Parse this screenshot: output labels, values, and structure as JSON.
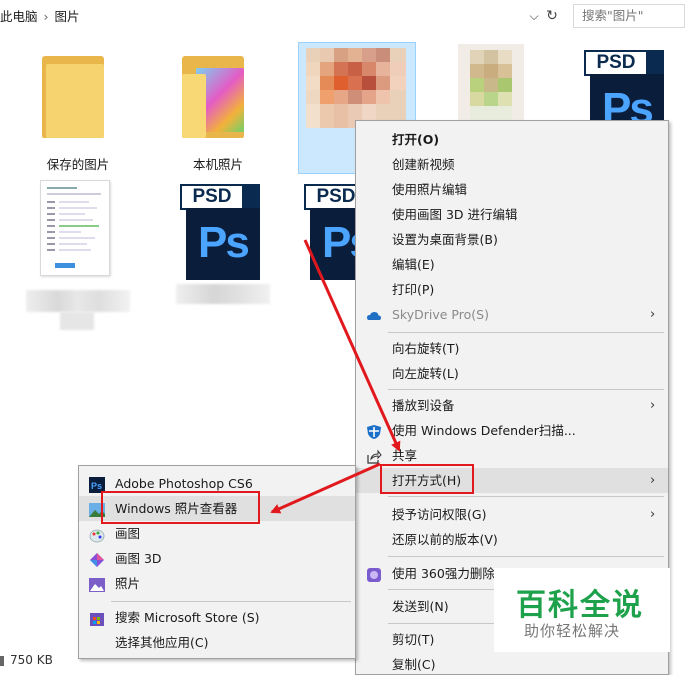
{
  "address_bar": {
    "path": [
      "此电脑",
      "图片"
    ],
    "separator": "›",
    "search_placeholder": "搜索\"图片\""
  },
  "items": [
    {
      "label": "保存的图片",
      "type": "folder"
    },
    {
      "label": "本机照片",
      "type": "folder"
    },
    {
      "label": "",
      "type": "image"
    },
    {
      "label": "",
      "type": "image"
    },
    {
      "label": "",
      "type": "psd"
    },
    {
      "label": "",
      "type": "document"
    },
    {
      "label": "",
      "type": "psd"
    },
    {
      "label": "",
      "type": "psd"
    }
  ],
  "psd_badge": {
    "top": "PSD",
    "body": "Ps"
  },
  "context_menu": {
    "items": [
      {
        "label": "打开(O)",
        "bold": true
      },
      {
        "label": "创建新视频"
      },
      {
        "label": "使用照片编辑"
      },
      {
        "label": "使用画图 3D 进行编辑"
      },
      {
        "label": "设置为桌面背景(B)"
      },
      {
        "label": "编辑(E)"
      },
      {
        "label": "打印(P)"
      },
      {
        "label": "SkyDrive Pro(S)",
        "disabled": true,
        "submenu": true,
        "icon": "cloud-icon"
      },
      {
        "label": "向右旋转(T)"
      },
      {
        "label": "向左旋转(L)"
      },
      {
        "label": "播放到设备",
        "submenu": true
      },
      {
        "label": "使用 Windows Defender扫描...",
        "icon": "defender-shield-icon"
      },
      {
        "label": "共享",
        "icon": "share-icon"
      },
      {
        "label": "打开方式(H)",
        "submenu": true,
        "highlighted": true
      },
      {
        "label": "授予访问权限(G)",
        "submenu": true
      },
      {
        "label": "还原以前的版本(V)"
      },
      {
        "label": "使用 360强力删除",
        "icon": "360-icon"
      },
      {
        "label": "发送到(N)"
      },
      {
        "label": "剪切(T)"
      },
      {
        "label": "复制(C)"
      }
    ]
  },
  "open_with_menu": {
    "items": [
      {
        "label": "Adobe Photoshop CS6",
        "icon": "photoshop-icon"
      },
      {
        "label": "Windows 照片查看器",
        "icon": "photo-viewer-icon",
        "highlighted": true
      },
      {
        "label": "画图",
        "icon": "paint-icon"
      },
      {
        "label": "画图 3D",
        "icon": "paint-3d-icon"
      },
      {
        "label": "照片",
        "icon": "photos-icon"
      },
      {
        "label": "搜索 Microsoft Store (S)",
        "icon": "store-icon"
      },
      {
        "label": "选择其他应用(C)"
      }
    ]
  },
  "status_bar": {
    "size": "750 KB"
  },
  "watermark": {
    "title": "百科全说",
    "subtitle": "助你轻松解决"
  },
  "colors": {
    "annotation_red": "#e1191e",
    "selection": "#cce8ff",
    "menu_bg": "#f2f2f2",
    "watermark_green": "#1ea14b",
    "ps_blue": "#4ba4ff"
  }
}
